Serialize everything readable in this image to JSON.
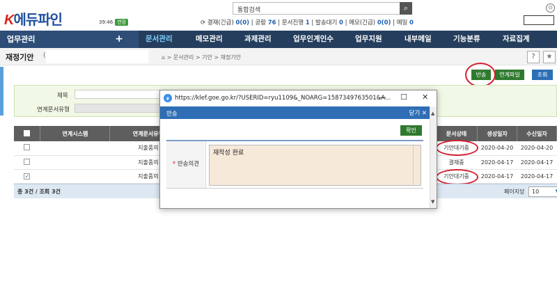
{
  "header": {
    "logo_k": "K",
    "logo_text": "에듀파인",
    "timer": "39:46",
    "extend_label": "연장",
    "search_placeholder": "통합검색",
    "status": {
      "approval": "결재(긴급)",
      "approval_count": "0(0)",
      "public_notice": "공람",
      "public_notice_count": "76",
      "doc_progress": "문서진행",
      "doc_progress_count": "1",
      "send_wait": "발송대기",
      "send_wait_count": "0",
      "memo": "메모(긴급)",
      "memo_count": "0(0)",
      "mail": "메일",
      "mail_count": "0"
    }
  },
  "nav": {
    "work": "업무관리",
    "plus": "+",
    "menus": [
      "문서관리",
      "메모관리",
      "과제관리",
      "업무인계인수",
      "업무지원",
      "내부메일",
      "기능분류",
      "자료집계"
    ]
  },
  "subbar": {
    "title": "재정기안",
    "paren": "(",
    "breadcrumb": "> 문서관리 > 기안 > 재정기안"
  },
  "actions": {
    "return": "반송",
    "link_file": "연계파일",
    "query": "조회"
  },
  "filter": {
    "subject_label": "제목",
    "linked_doc_type_label": "연계문서유형"
  },
  "table": {
    "headers": [
      "연계시스템",
      "연계문서유형",
      "문서상태",
      "생성일자",
      "수신일자"
    ],
    "rows": [
      {
        "checked": false,
        "system": "",
        "type": "지출품의",
        "state": "기안대기중",
        "created": "2020-04-20",
        "received": "2020-04-20"
      },
      {
        "checked": false,
        "system": "",
        "type": "지출품의",
        "state": "결재중",
        "created": "2020-04-17",
        "received": "2020-04-17"
      },
      {
        "checked": true,
        "system": "",
        "type": "지출품의",
        "state": "기안대기중",
        "created": "2020-04-17",
        "received": "2020-04-17"
      }
    ],
    "footer_count": "총 3건 / 조회 3건",
    "per_page_label": "페이지당",
    "per_page_value": "10"
  },
  "popup": {
    "url": "https://klef.goe.go.kr/?USERID=ryu1109&_NOARG=1587349763501&A...",
    "title": "반송",
    "close_label": "닫기",
    "confirm_label": "확인",
    "field_label": "반송의견",
    "field_value": "재작성 완료"
  },
  "colors": {
    "nav_bg": "#253e5d",
    "accent_blue": "#2f6eb5",
    "green_button": "#2f7a2f",
    "highlight_red": "#d41f2e"
  }
}
